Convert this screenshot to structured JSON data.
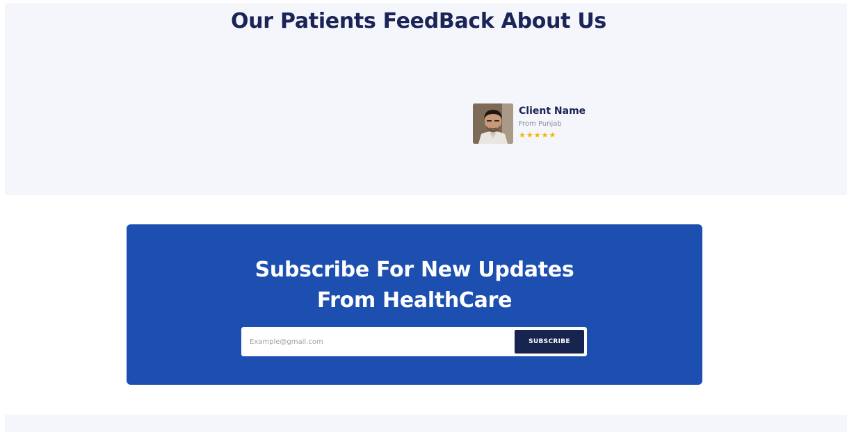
{
  "feedback": {
    "title": "Our Patients FeedBack About Us",
    "testimonial": {
      "client_name": "Client Name",
      "location": "From Punjab",
      "rating": 5,
      "stars": "★★★★★",
      "avatar_icon": "client-photo"
    }
  },
  "subscribe": {
    "title_line1": "Subscribe For New Updates",
    "title_line2": "From HealthCare",
    "email_placeholder": "Example@gmail.com",
    "button_label": "SUBSCRIBE"
  },
  "colors": {
    "navy": "#1a2456",
    "brand_blue": "#1c4fb0",
    "button_dark": "#16244f",
    "section_bg": "#f4f6fb",
    "star_gold": "#f5b400"
  }
}
